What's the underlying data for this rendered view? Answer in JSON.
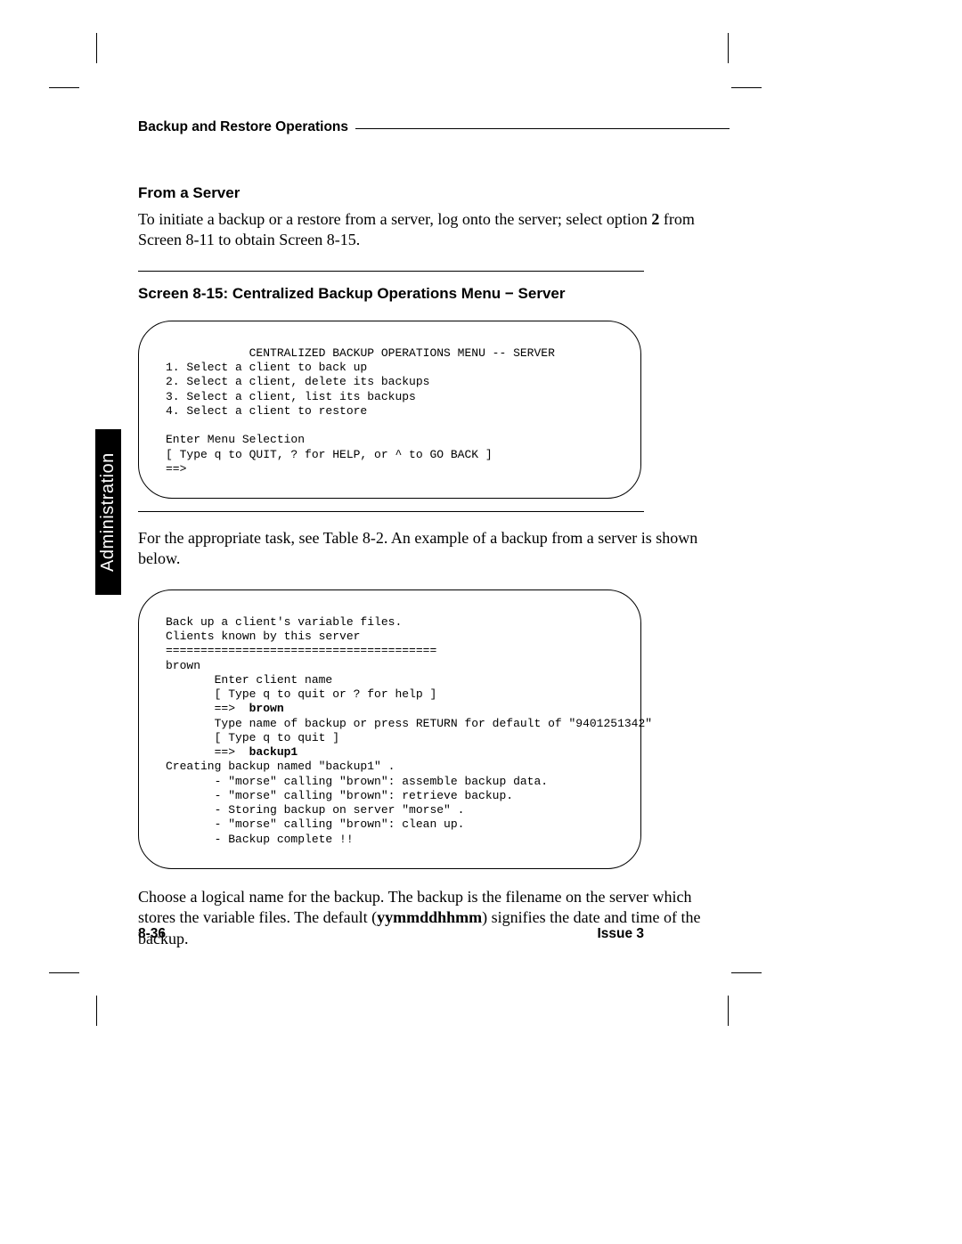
{
  "header": {
    "running_head": "Backup and Restore Operations",
    "side_tab": "Administration"
  },
  "section": {
    "title": "From a Server",
    "intro_pre": "To initiate a backup or a restore from a server, log onto the server; select option ",
    "intro_bold": "2",
    "intro_post": " from Screen 8-11 to obtain Screen 8-15."
  },
  "screen_caption": "Screen 8-15:  Centralized Backup Operations Menu − Server",
  "screen1": {
    "title": "CENTRALIZED BACKUP OPERATIONS MENU -- SERVER",
    "line1": "1. Select a client to back up",
    "line2": "2. Select a client, delete its backups",
    "line3": "3. Select a client, list its backups",
    "line4": "4. Select a client to restore",
    "line5": "Enter Menu Selection",
    "line6": "[ Type q to QUIT, ? for HELP, or ^ to GO BACK ]",
    "line7": "==>"
  },
  "mid_para": "For the appropriate task, see Table 8-2.  An example of a backup from a server is shown below.",
  "screen2": {
    "l1": "Back up a client's variable files.",
    "l2": "Clients known by this server",
    "l3": "=======================================",
    "l4": "brown",
    "l5": "       Enter client name",
    "l6": "       [ Type q to quit or ? for help ]",
    "l7a": "       ==>  ",
    "l7b": "brown",
    "l8": "       Type name of backup or press RETURN for default of \"9401251342\"",
    "l9": "       [ Type q to quit ]",
    "l10a": "       ==>  ",
    "l10b": "backup1",
    "l11": "Creating backup named \"backup1\" .",
    "l12": "       - \"morse\" calling \"brown\": assemble backup data.",
    "l13": "       - \"morse\" calling \"brown\": retrieve backup.",
    "l14": "       - Storing backup on server \"morse\" .",
    "l15": "       - \"morse\" calling \"brown\": clean up.",
    "l16": "       - Backup complete !!"
  },
  "closing": {
    "pre": "Choose a logical name for the backup.  The backup is the filename on the server which stores the variable files.  The default (",
    "bold": "yymmddhhmm",
    "post": ") signifies the date and time of the backup."
  },
  "footer": {
    "left": "8-36",
    "right": "Issue 3"
  }
}
